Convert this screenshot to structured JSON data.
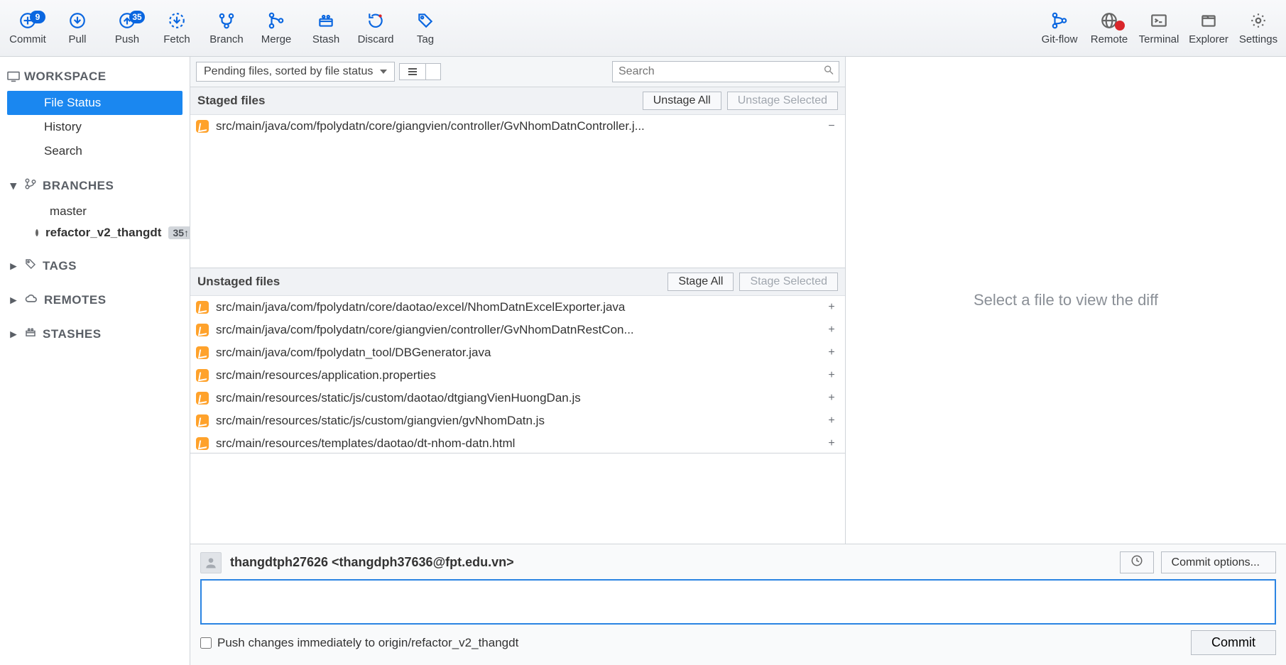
{
  "toolbar": {
    "commit": {
      "label": "Commit",
      "badge": "9"
    },
    "pull": {
      "label": "Pull"
    },
    "push": {
      "label": "Push",
      "badge": "35"
    },
    "fetch": {
      "label": "Fetch"
    },
    "branch": {
      "label": "Branch"
    },
    "merge": {
      "label": "Merge"
    },
    "stash": {
      "label": "Stash"
    },
    "discard": {
      "label": "Discard"
    },
    "tag": {
      "label": "Tag"
    },
    "gitflow": {
      "label": "Git-flow"
    },
    "remote": {
      "label": "Remote"
    },
    "terminal": {
      "label": "Terminal"
    },
    "explorer": {
      "label": "Explorer"
    },
    "settings": {
      "label": "Settings"
    }
  },
  "sidebar": {
    "workspace": {
      "title": "WORKSPACE",
      "items": [
        "File Status",
        "History",
        "Search"
      ],
      "selected": 0
    },
    "branches": {
      "title": "BRANCHES",
      "items": [
        {
          "name": "master",
          "current": false,
          "count": null
        },
        {
          "name": "refactor_v2_thangdt",
          "current": true,
          "count": "35↑"
        }
      ]
    },
    "tags": {
      "title": "TAGS"
    },
    "remotes": {
      "title": "REMOTES"
    },
    "stashes": {
      "title": "STASHES"
    }
  },
  "center": {
    "sort_label": "Pending files, sorted by file status",
    "search_placeholder": "Search",
    "staged": {
      "title": "Staged files",
      "unstage_all": "Unstage All",
      "unstage_selected": "Unstage Selected",
      "files": [
        "src/main/java/com/fpolydatn/core/giangvien/controller/GvNhomDatnController.j..."
      ]
    },
    "unstaged": {
      "title": "Unstaged files",
      "stage_all": "Stage All",
      "stage_selected": "Stage Selected",
      "files": [
        "src/main/java/com/fpolydatn/core/daotao/excel/NhomDatnExcelExporter.java",
        "src/main/java/com/fpolydatn/core/giangvien/controller/GvNhomDatnRestCon...",
        "src/main/java/com/fpolydatn_tool/DBGenerator.java",
        "src/main/resources/application.properties",
        "src/main/resources/static/js/custom/daotao/dtgiangVienHuongDan.js",
        "src/main/resources/static/js/custom/giangvien/gvNhomDatn.js",
        "src/main/resources/templates/daotao/dt-nhom-datn.html"
      ]
    }
  },
  "diff": {
    "placeholder": "Select a file to view the diff"
  },
  "commit": {
    "author": "thangdtph27626 <thangdph37636@fpt.edu.vn>",
    "options_label": "Commit options...",
    "message": "",
    "push_label": "Push changes immediately to origin/refactor_v2_thangdt",
    "commit_btn": "Commit"
  }
}
